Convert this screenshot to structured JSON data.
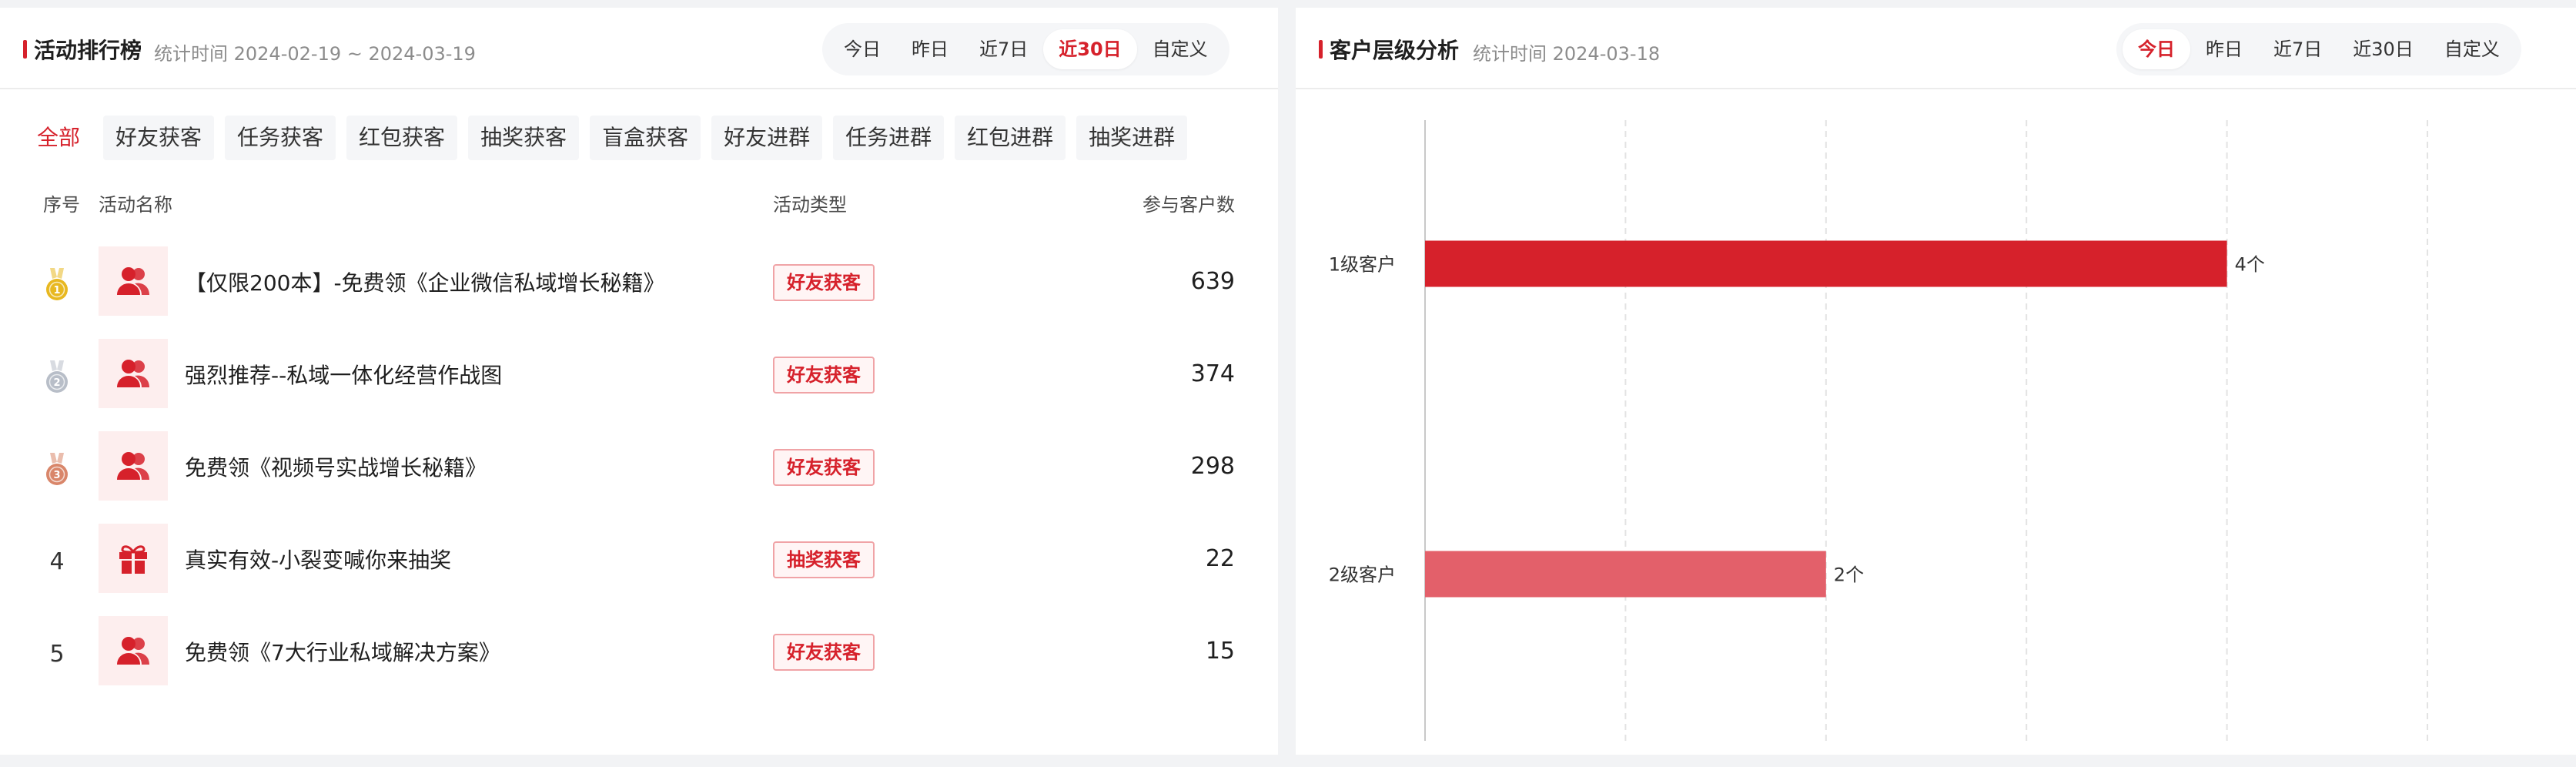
{
  "ranking": {
    "title": "活动排行榜",
    "subtitle": "统计时间 2024-02-19 ~ 2024-03-19",
    "ranges": [
      "今日",
      "昨日",
      "近7日",
      "近30日",
      "自定义"
    ],
    "active_range": "近30日",
    "filters": [
      "全部",
      "好友获客",
      "任务获客",
      "红包获客",
      "抽奖获客",
      "盲盒获客",
      "好友进群",
      "任务进群",
      "红包进群",
      "抽奖进群"
    ],
    "active_filter": "全部",
    "columns": {
      "index": "序号",
      "name": "活动名称",
      "type": "活动类型",
      "count": "参与客户数"
    },
    "rows": [
      {
        "rank": "1",
        "medal": "gold",
        "icon": "users-icon",
        "name": "【仅限200本】-免费领《企业微信私域增长秘籍》",
        "type": "好友获客",
        "count": "639"
      },
      {
        "rank": "2",
        "medal": "silver",
        "icon": "users-icon",
        "name": "强烈推荐--私域一体化经营作战图",
        "type": "好友获客",
        "count": "374"
      },
      {
        "rank": "3",
        "medal": "bronze",
        "icon": "users-icon",
        "name": "免费领《视频号实战增长秘籍》",
        "type": "好友获客",
        "count": "298"
      },
      {
        "rank": "4",
        "medal": "",
        "icon": "gift-icon",
        "name": "真实有效-小裂变喊你来抽奖",
        "type": "抽奖获客",
        "count": "22"
      },
      {
        "rank": "5",
        "medal": "",
        "icon": "users-icon",
        "name": "免费领《7大行业私域解决方案》",
        "type": "好友获客",
        "count": "15"
      }
    ]
  },
  "customer_level": {
    "title": "客户层级分析",
    "subtitle": "统计时间 2024-03-18",
    "ranges": [
      "今日",
      "昨日",
      "近7日",
      "近30日",
      "自定义"
    ],
    "active_range": "今日"
  },
  "chart_data": {
    "type": "bar",
    "orientation": "horizontal",
    "categories": [
      "1级客户",
      "2级客户"
    ],
    "values": [
      4,
      2
    ],
    "data_labels": [
      "4个",
      "2个"
    ],
    "xlim": [
      0,
      5
    ],
    "grid": true,
    "colors": [
      "#d6212b",
      "#e3606a"
    ]
  },
  "colors": {
    "accent": "#d6212b",
    "tag_border": "#f0a3a6",
    "thumb_bg": "#fdeeee",
    "gold": "#e8b820",
    "silver": "#b8bec8",
    "bronze": "#d9866a"
  }
}
